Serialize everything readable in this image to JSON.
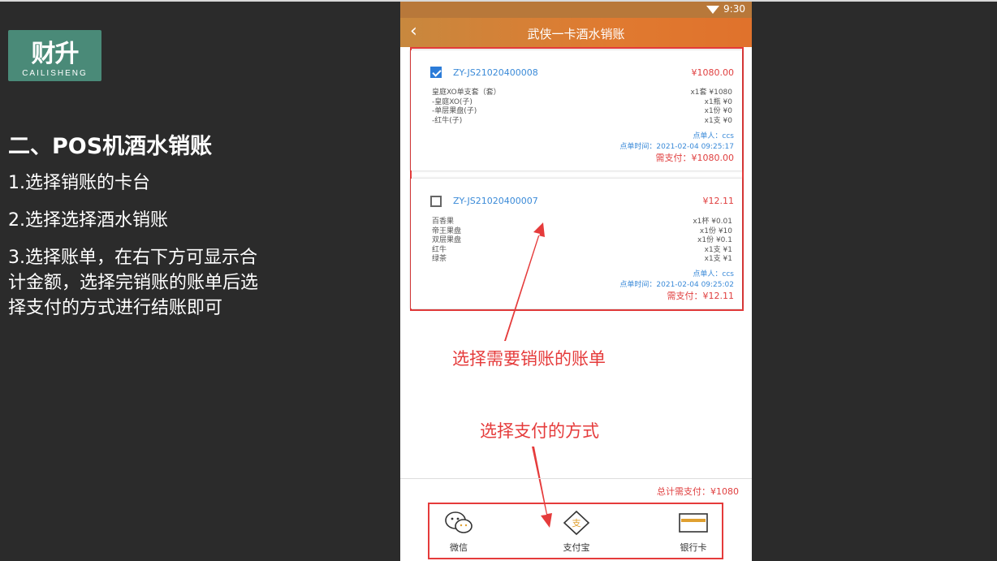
{
  "logo": {
    "mark": "财升",
    "text": "CAILISHENG"
  },
  "left": {
    "title": "二、POS机酒水销账",
    "steps": [
      "1.选择销账的卡台",
      "2.选择选择酒水销账",
      "3.选择账单，在右下方可显示合计金额，选择完销账的账单后选择支付的方式进行结账即可"
    ]
  },
  "phone": {
    "time": "9:30",
    "title": "武侠一卡酒水销账",
    "bills": [
      {
        "checked": true,
        "order_no": "ZY-JS21020400008",
        "amount": "¥1080.00",
        "items": [
          {
            "name": "皇庭XO单支套（套）",
            "qty": "x1套 ¥1080"
          },
          {
            "name": "-皇庭XO(子)",
            "qty": "x1瓶 ¥0"
          },
          {
            "name": "-单层果盘(子)",
            "qty": "x1份 ¥0"
          },
          {
            "name": "-红牛(子)",
            "qty": "x1支 ¥0"
          }
        ],
        "orderer": "点单人：ccs",
        "order_time": "点单时间：2021-02-04 09:25:17",
        "due": "需支付：¥1080.00"
      },
      {
        "checked": false,
        "order_no": "ZY-JS21020400007",
        "amount": "¥12.11",
        "items": [
          {
            "name": "百香果",
            "qty": "x1杯 ¥0.01"
          },
          {
            "name": "帝王果盘",
            "qty": "x1份 ¥10"
          },
          {
            "name": "双层果盘",
            "qty": "x1份 ¥0.1"
          },
          {
            "name": "红牛",
            "qty": "x1支 ¥1"
          },
          {
            "name": "绿茶",
            "qty": "x1支 ¥1"
          }
        ],
        "orderer": "点单人：ccs",
        "order_time": "点单时间：2021-02-04 09:25:02",
        "due": "需支付：¥12.11"
      }
    ],
    "annotation_bill": "选择需要销账的账单",
    "annotation_pay": "选择支付的方式",
    "total": "总计需支付：¥1080",
    "pay_options": [
      "微信",
      "支付宝",
      "银行卡"
    ]
  },
  "colors": {
    "accent": "#e07a30",
    "annotation": "#e53b3b",
    "link": "#3a8ad8"
  }
}
